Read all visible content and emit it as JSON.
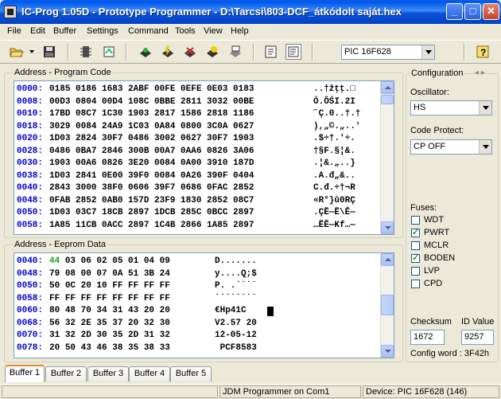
{
  "window": {
    "title": "IC-Prog 1.05D - Prototype Programmer - D:\\Tarcsi\\803-DCF_átkódolt saját.hex"
  },
  "menu": [
    "File",
    "Edit",
    "Buffer",
    "Settings",
    "Command",
    "Tools",
    "View",
    "Help"
  ],
  "toolbar": {
    "device": "PIC 16F628"
  },
  "program_code": {
    "title": "Address - Program Code",
    "rows": [
      {
        "addr": "0000:",
        "words": "0185 0186 1683 2ABF 00FE 0EFE 0E03 0183",
        "ascii": "..†žţţ.□"
      },
      {
        "addr": "0008:",
        "words": "00D3 0804 00D4 108C 0BBE 2811 3032 00BE",
        "ascii": "Ó.ÔŚI.2I"
      },
      {
        "addr": "0010:",
        "words": "17BD 08C7 1C30 1903 2817 1586 2818 1186",
        "ascii": "˝Ç.0..†.†"
      },
      {
        "addr": "0018:",
        "words": "3029 0084 24A9 1C03 0A84 0800 3C0A 0627",
        "ascii": "),„©.„..'"
      },
      {
        "addr": "0020:",
        "words": "1D03 2824 30F7 0486 3002 0627 30F7 1903",
        "ascii": ".$÷†.'÷."
      },
      {
        "addr": "0028:",
        "words": "0486 0BA7 2846 300B 00A7 0AA6 0826 3A06",
        "ascii": "†§F.§¦&."
      },
      {
        "addr": "0030:",
        "words": "1903 00A6 0826 3E20 0084 0A00 3910 187D",
        "ascii": ".¦&.„..}"
      },
      {
        "addr": "0038:",
        "words": "1D03 2841 0E00 39F0 0084 0A26 390F 0404",
        "ascii": ".A.đ„&.."
      },
      {
        "addr": "0040:",
        "words": "2843 3000 38F0 0606 39F7 0686 0FAC 2852",
        "ascii": "C.đ.÷†¬R"
      },
      {
        "addr": "0048:",
        "words": "0FAB 2852 0AB0 157D 23F9 1830 2852 08C7",
        "ascii": "«R°}ů0RÇ"
      },
      {
        "addr": "0050:",
        "words": "1D03 03C7 18CB 2897 1DCB 285C 0BCC 2897",
        "ascii": ".ÇË—Ë\\Ě—"
      },
      {
        "addr": "0058:",
        "words": "1A85 11CB 0ACC 2897 1C4B 2866 1A85 2897",
        "ascii": "…ËĚ—Kf…—"
      }
    ]
  },
  "eeprom": {
    "title": "Address - Eeprom Data",
    "rows": [
      {
        "addr": "0040:",
        "first": "44",
        "bytes": " 03 06 02 05 01 04 09",
        "ascii": "D......."
      },
      {
        "addr": "0048:",
        "first": "",
        "bytes": "79 08 00 07 0A 51 3B 24",
        "ascii": "y....Q;$"
      },
      {
        "addr": "0050:",
        "first": "",
        "bytes": "50 0C 20 10 FF FF FF FF",
        "ascii": "P. .˙˙˙˙"
      },
      {
        "addr": "0058:",
        "first": "",
        "bytes": "FF FF FF FF FF FF FF FF",
        "ascii": "˙˙˙˙˙˙˙˙"
      },
      {
        "addr": "0060:",
        "first": "",
        "bytes": "80 48 70 34 31 43 20 20",
        "ascii": "€Hp41C  "
      },
      {
        "addr": "0068:",
        "first": "",
        "bytes": "56 32 2E 35 37 20 32 30",
        "ascii": "V2.57 20"
      },
      {
        "addr": "0070:",
        "first": "",
        "bytes": "31 32 2D 30 35 2D 31 32",
        "ascii": "12-05-12"
      },
      {
        "addr": "0078:",
        "first": "",
        "bytes": "20 50 43 46 38 35 38 33",
        "ascii": " PCF8583"
      }
    ]
  },
  "config": {
    "title": "Configuration",
    "oscillator_label": "Oscillator:",
    "oscillator_value": "HS",
    "code_protect_label": "Code Protect:",
    "code_protect_value": "CP OFF",
    "fuses_label": "Fuses:",
    "fuses": [
      {
        "name": "WDT",
        "checked": false
      },
      {
        "name": "PWRT",
        "checked": true
      },
      {
        "name": "MCLR",
        "checked": false
      },
      {
        "name": "BODEN",
        "checked": true
      },
      {
        "name": "LVP",
        "checked": false
      },
      {
        "name": "CPD",
        "checked": false
      }
    ],
    "checksum_label": "Checksum",
    "checksum_value": "1672",
    "id_label": "ID Value",
    "id_value": "9257",
    "config_word": "Config word : 3F42h"
  },
  "tabs": [
    "Buffer 1",
    "Buffer 2",
    "Buffer 3",
    "Buffer 4",
    "Buffer 5"
  ],
  "status": {
    "programmer": "JDM Programmer on Com1",
    "device": "Device: PIC 16F628  (146)"
  },
  "colors": {
    "title_bar": "#0058ee",
    "address": "#0000d0",
    "highlight": "#21a121"
  }
}
